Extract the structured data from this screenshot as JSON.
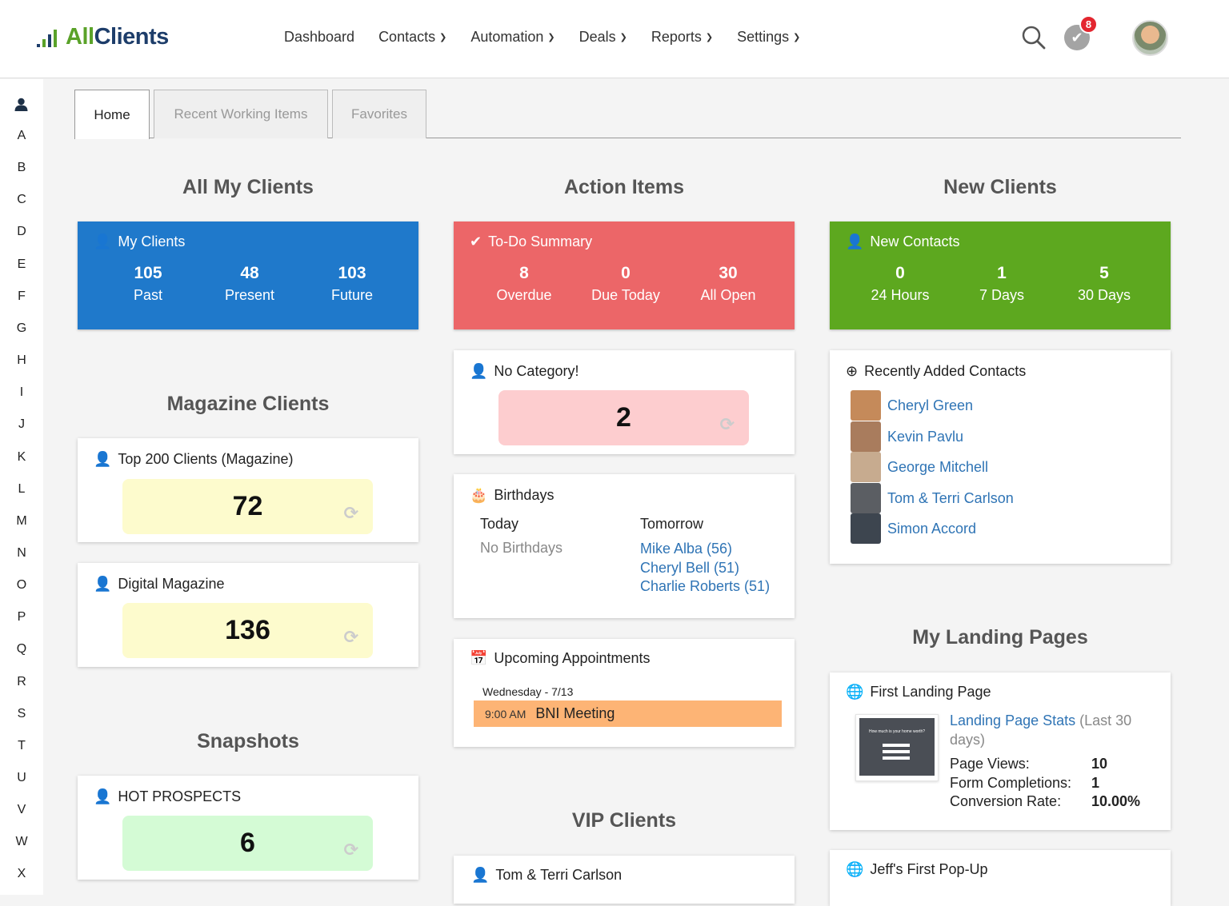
{
  "app": {
    "brand_all": "All",
    "brand_clients": "Clients"
  },
  "nav": [
    {
      "label": "Dashboard",
      "dropdown": false
    },
    {
      "label": "Contacts",
      "dropdown": true
    },
    {
      "label": "Automation",
      "dropdown": true
    },
    {
      "label": "Deals",
      "dropdown": true
    },
    {
      "label": "Reports",
      "dropdown": true
    },
    {
      "label": "Settings",
      "dropdown": true
    }
  ],
  "header": {
    "notification_count": "8"
  },
  "alphabet": [
    "A",
    "B",
    "C",
    "D",
    "E",
    "F",
    "G",
    "H",
    "I",
    "J",
    "K",
    "L",
    "M",
    "N",
    "O",
    "P",
    "Q",
    "R",
    "S",
    "T",
    "U",
    "V",
    "W",
    "X"
  ],
  "tabs": {
    "home": "Home",
    "recent": "Recent Working Items",
    "favorites": "Favorites"
  },
  "columns": {
    "left": {
      "title": "All My Clients",
      "stat": {
        "title": "My Clients",
        "color": "#1f79cb",
        "items": [
          {
            "num": "105",
            "label": "Past"
          },
          {
            "num": "48",
            "label": "Present"
          },
          {
            "num": "103",
            "label": "Future"
          }
        ]
      },
      "magazine_title": "Magazine Clients",
      "top200": {
        "title": "Top 200 Clients (Magazine)",
        "value": "72"
      },
      "digital": {
        "title": "Digital Magazine",
        "value": "136"
      },
      "snapshots_title": "Snapshots",
      "hot": {
        "title": "HOT PROSPECTS",
        "value": "6"
      }
    },
    "middle": {
      "title": "Action Items",
      "stat": {
        "title": "To-Do Summary",
        "color": "#ec6668",
        "items": [
          {
            "num": "8",
            "label": "Overdue"
          },
          {
            "num": "0",
            "label": "Due Today"
          },
          {
            "num": "30",
            "label": "All Open"
          }
        ]
      },
      "nocat": {
        "title": "No Category!",
        "value": "2"
      },
      "birthdays": {
        "title": "Birthdays",
        "today": "Today",
        "tomorrow": "Tomorrow",
        "none": "No Birthdays",
        "list": [
          "Mike Alba (56)",
          "Cheryl Bell (51)",
          "Charlie Roberts (51)"
        ]
      },
      "appointments": {
        "title": "Upcoming Appointments",
        "day": "Wednesday - 7/13",
        "time": "9:00 AM",
        "name": "BNI Meeting"
      },
      "vip_title": "VIP Clients",
      "vip_card": "Tom & Terri Carlson"
    },
    "right": {
      "title": "New Clients",
      "stat": {
        "title": "New Contacts",
        "color": "#5da81f",
        "items": [
          {
            "num": "0",
            "label": "24 Hours"
          },
          {
            "num": "1",
            "label": "7 Days"
          },
          {
            "num": "5",
            "label": "30 Days"
          }
        ]
      },
      "recent": {
        "title": "Recently Added Contacts",
        "contacts": [
          "Cheryl Green",
          "Kevin Pavlu",
          "George Mitchell",
          "Tom & Terri Carlson",
          "Simon Accord"
        ]
      },
      "landing_title": "My Landing Pages",
      "landing": {
        "title": "First Landing Page",
        "stats_link": "Landing Page Stats",
        "stats_period": " (Last 30 days)",
        "rows": [
          {
            "label": "Page Views:",
            "value": "10"
          },
          {
            "label": "Form Completions:",
            "value": "1"
          },
          {
            "label": "Conversion Rate:",
            "value": "10.00%"
          }
        ],
        "thumb_text": "How much is your home worth?"
      },
      "popup": {
        "title": "Jeff's First Pop-Up"
      }
    }
  }
}
